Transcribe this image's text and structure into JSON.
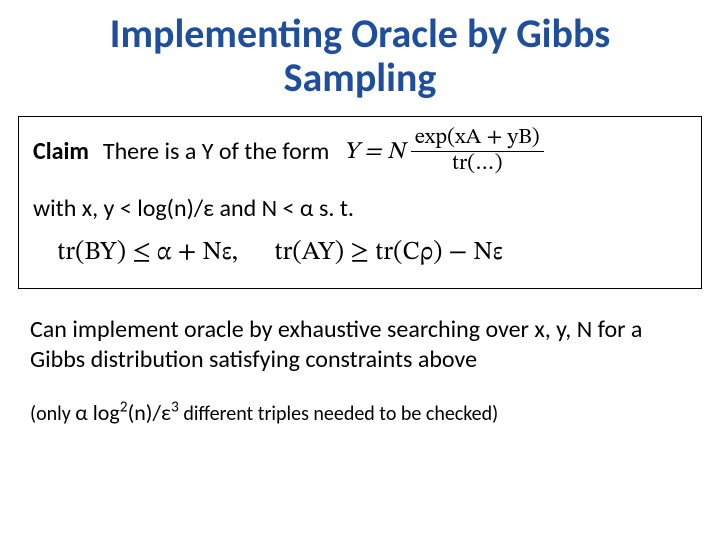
{
  "title": "Implementing Oracle by Gibbs Sampling",
  "claim": {
    "label": "Claim",
    "lead": "There is a Y of the form",
    "eq_lhs": "Y = N",
    "frac_num": "exp(xA + yB)",
    "frac_den": "tr(…)",
    "line2": "with x, y < log(n)/ε and N < α s. t.",
    "ineq_left_pre": "tr(BY) ≤ α + Nε,",
    "ineq_right": "tr(AY) ≥ tr(Cρ) − Nε"
  },
  "body": {
    "p1": "Can implement oracle by exhaustive searching over x, y, N for a Gibbs distribution satisfying constraints above",
    "p2_pre": "(only ",
    "p2_expr_a": "α log",
    "p2_sup1": "2",
    "p2_expr_b": "(n)/ε",
    "p2_sup2": "3",
    "p2_post": " different triples needed to be checked)"
  }
}
